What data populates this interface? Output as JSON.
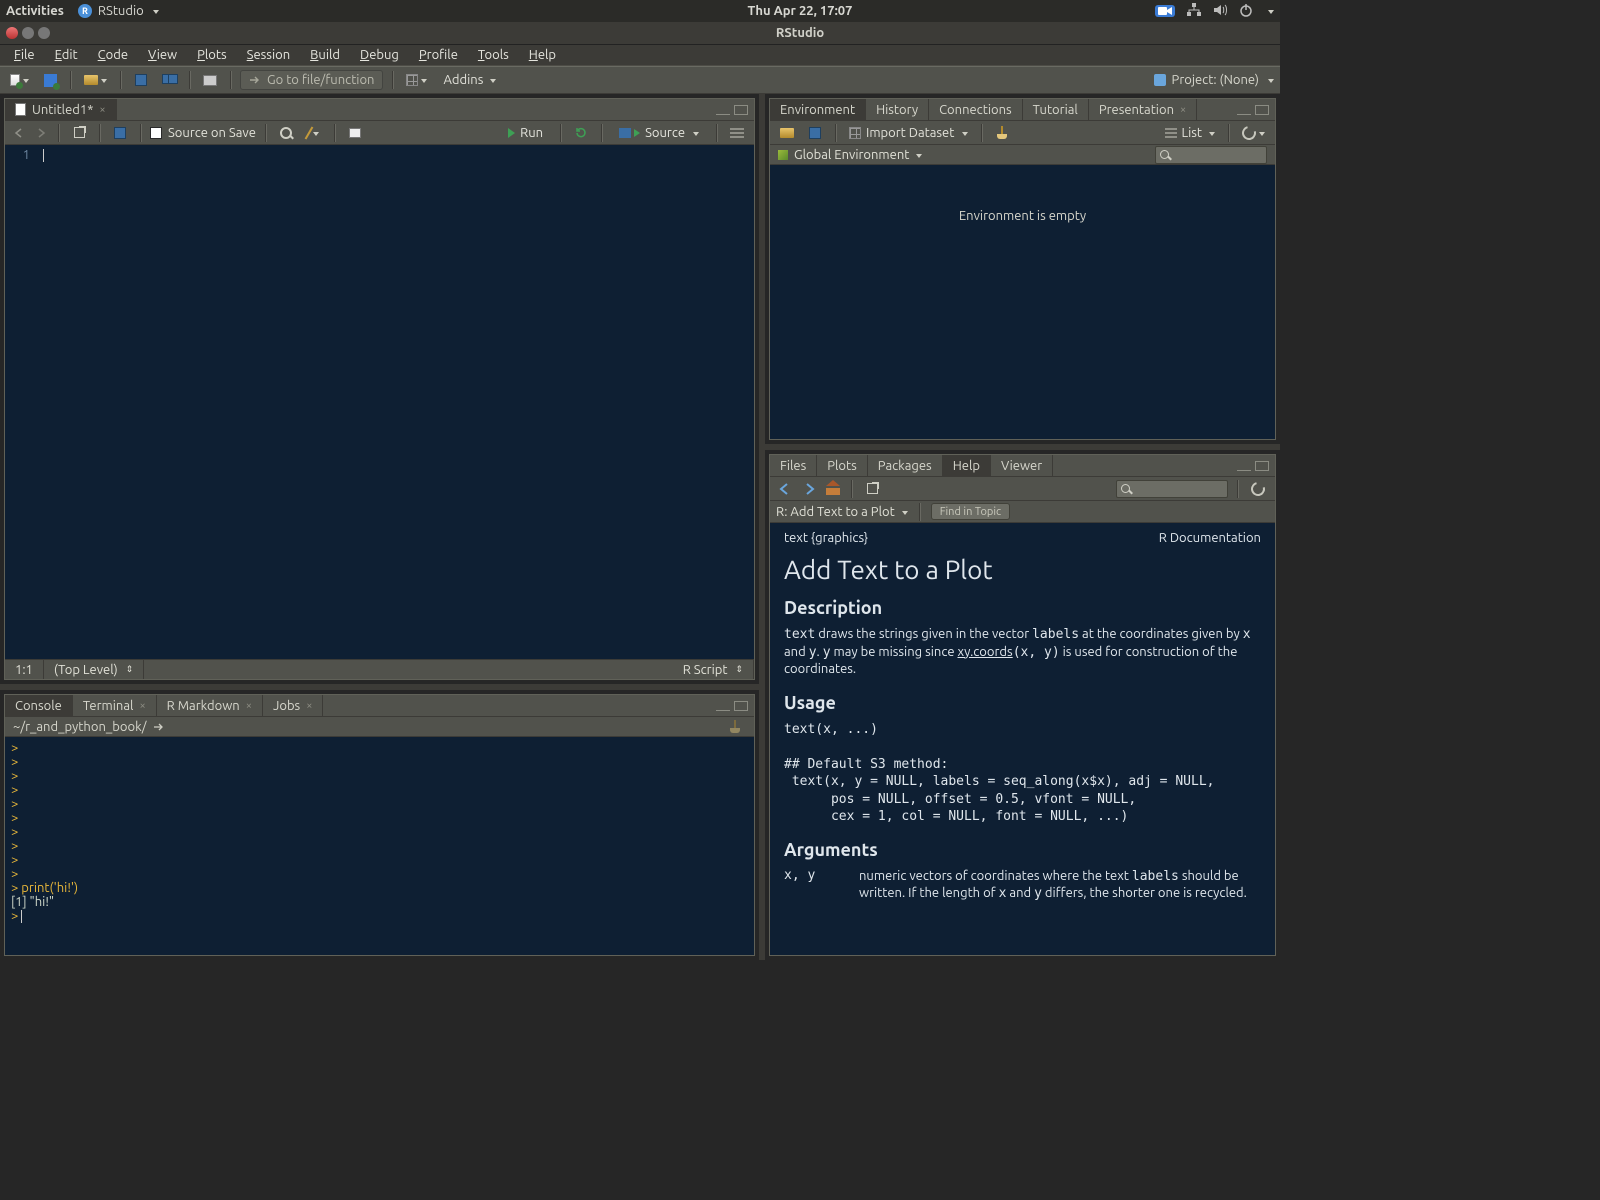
{
  "gnome": {
    "activities": "Activities",
    "app_name": "RStudio",
    "clock": "Thu Apr 22, 17:07"
  },
  "titlebar": {
    "title": "RStudio"
  },
  "menubar": [
    "File",
    "Edit",
    "Code",
    "View",
    "Plots",
    "Session",
    "Build",
    "Debug",
    "Profile",
    "Tools",
    "Help"
  ],
  "toolbar": {
    "goto_placeholder": "Go to file/function",
    "addins": "Addins",
    "project_label": "Project: (None)"
  },
  "source_pane": {
    "tab_label": "Untitled1*",
    "source_on_save": "Source on Save",
    "run": "Run",
    "source_btn": "Source",
    "line_numbers": [
      "1"
    ],
    "status_pos": "1:1",
    "status_scope": "(Top Level)",
    "status_lang": "R Script"
  },
  "console_pane": {
    "tabs": [
      "Console",
      "Terminal",
      "R Markdown",
      "Jobs"
    ],
    "path": "~/r_and_python_book/",
    "lines": [
      {
        "t": "prompt",
        "v": ">"
      },
      {
        "t": "prompt",
        "v": ">"
      },
      {
        "t": "prompt",
        "v": ">"
      },
      {
        "t": "prompt",
        "v": ">"
      },
      {
        "t": "prompt",
        "v": ">"
      },
      {
        "t": "prompt",
        "v": ">"
      },
      {
        "t": "prompt",
        "v": ">"
      },
      {
        "t": "prompt",
        "v": ">"
      },
      {
        "t": "prompt",
        "v": ">"
      },
      {
        "t": "prompt",
        "v": ">"
      },
      {
        "t": "cmd",
        "v": "> print('hi!')"
      },
      {
        "t": "out",
        "v": "[1] \"hi!\""
      },
      {
        "t": "prompt_cursor",
        "v": "> "
      }
    ]
  },
  "env_pane": {
    "tabs": [
      "Environment",
      "History",
      "Connections",
      "Tutorial",
      "Presentation"
    ],
    "import": "Import Dataset",
    "view": "List",
    "scope": "Global Environment",
    "empty": "Environment is empty"
  },
  "help_pane": {
    "tabs": [
      "Files",
      "Plots",
      "Packages",
      "Help",
      "Viewer"
    ],
    "breadcrumb": "R: Add Text to a Plot",
    "find_placeholder": "Find in Topic",
    "pkg_header_left": "text {graphics}",
    "pkg_header_right": "R Documentation",
    "title": "Add Text to a Plot",
    "h_desc": "Description",
    "desc_1a": "text",
    "desc_1b": " draws the strings given in the vector ",
    "desc_1c": "labels",
    "desc_1d": " at the coordinates given by ",
    "desc_1e": "x",
    "desc_1f": " and ",
    "desc_1g": "y",
    "desc_1h": ". ",
    "desc_1i": "y",
    "desc_1j": " may be missing since ",
    "desc_link": "xy.coords",
    "desc_1k": "(x, y)",
    "desc_1l": " is used for construction of the coordinates.",
    "h_usage": "Usage",
    "usage": "text(x, ...)\n\n## Default S3 method:\n text(x, y = NULL, labels = seq_along(x$x), adj = NULL,\n      pos = NULL, offset = 0.5, vfont = NULL,\n      cex = 1, col = NULL, font = NULL, ...)",
    "h_args": "Arguments",
    "arg1_name": "x, y",
    "arg1_a": "numeric vectors of coordinates where the text ",
    "arg1_b": "labels",
    "arg1_c": " should be written. If the length of ",
    "arg1_d": "x",
    "arg1_e": " and ",
    "arg1_f": "y",
    "arg1_g": " differs, the shorter one is recycled."
  }
}
